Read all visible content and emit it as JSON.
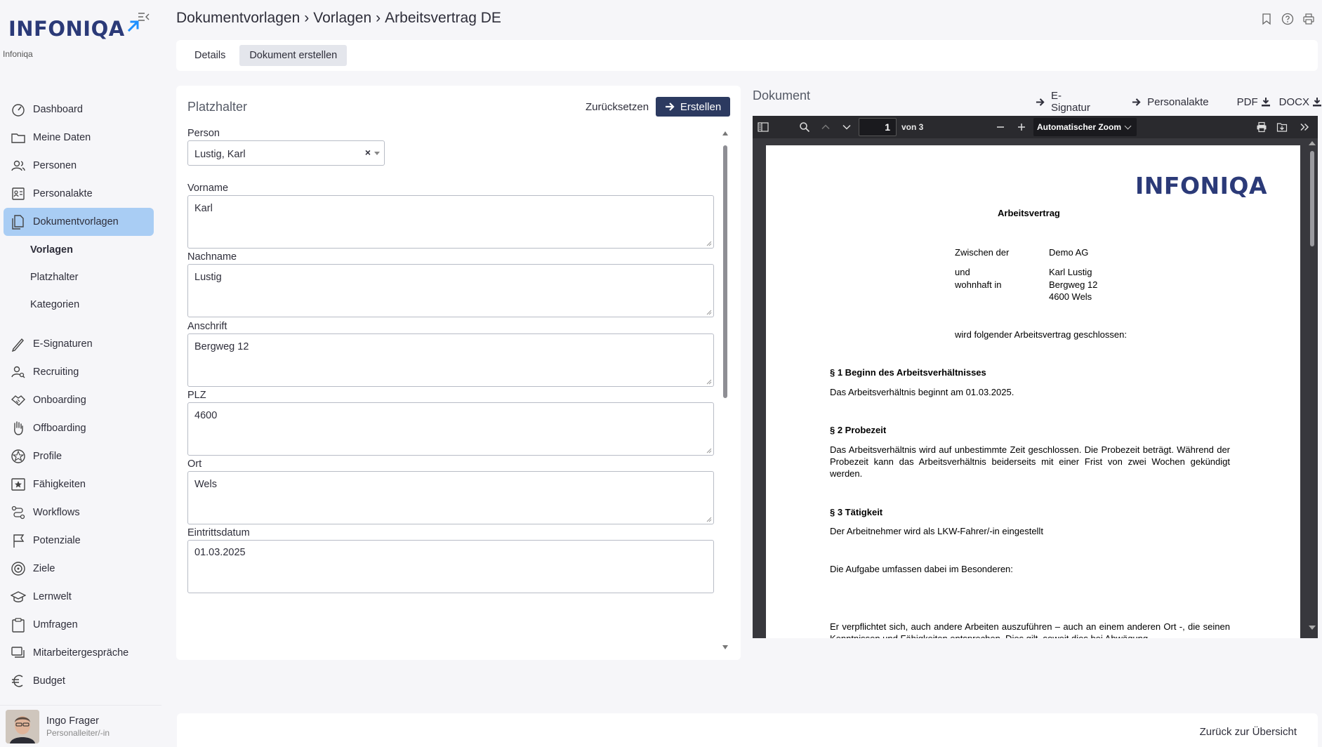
{
  "app": {
    "logo_text": "INFONIQA",
    "company": "Infoniqa",
    "brand_color": "#2b3a78",
    "accent_color": "#a9cdf4"
  },
  "breadcrumb": {
    "part1": "Dokumentvorlagen",
    "sep1": "›",
    "part2": "Vorlagen",
    "sep2": "›",
    "part3": "Arbeitsvertrag DE"
  },
  "header_icons": [
    "bookmark-icon",
    "help-icon",
    "print-icon"
  ],
  "sidebar": {
    "items": [
      {
        "label": "Dashboard",
        "icon": "dashboard-icon"
      },
      {
        "label": "Meine Daten",
        "icon": "folder-icon"
      },
      {
        "label": "Personen",
        "icon": "people-icon"
      },
      {
        "label": "Personalakte",
        "icon": "personnel-file-icon"
      },
      {
        "label": "Dokumentvorlagen",
        "icon": "documents-icon",
        "active": true
      },
      {
        "label": "E-Signaturen",
        "icon": "pen-icon"
      },
      {
        "label": "Recruiting",
        "icon": "recruiting-icon"
      },
      {
        "label": "Onboarding",
        "icon": "handshake-icon"
      },
      {
        "label": "Offboarding",
        "icon": "hand-icon"
      },
      {
        "label": "Profile",
        "icon": "profile-icon"
      },
      {
        "label": "Fähigkeiten",
        "icon": "star-icon"
      },
      {
        "label": "Workflows",
        "icon": "workflow-icon"
      },
      {
        "label": "Potenziale",
        "icon": "flag-icon"
      },
      {
        "label": "Ziele",
        "icon": "target-icon"
      },
      {
        "label": "Lernwelt",
        "icon": "graduation-icon"
      },
      {
        "label": "Umfragen",
        "icon": "clipboard-icon"
      },
      {
        "label": "Mitarbeitergespräche",
        "icon": "chat-icon"
      },
      {
        "label": "Budget",
        "icon": "euro-icon"
      }
    ],
    "sub_items": [
      {
        "label": "Vorlagen",
        "active": true
      },
      {
        "label": "Platzhalter"
      },
      {
        "label": "Kategorien"
      }
    ]
  },
  "user": {
    "name": "Ingo Frager",
    "role": "Personalleiter/-in"
  },
  "tabs": [
    {
      "label": "Details"
    },
    {
      "label": "Dokument erstellen",
      "active": true
    }
  ],
  "form": {
    "title": "Platzhalter",
    "reset_label": "Zurücksetzen",
    "create_label": "Erstellen",
    "person_label": "Person",
    "person_value": "Lustig, Karl",
    "clear_glyph": "×",
    "fields": [
      {
        "label": "Vorname",
        "value": "Karl"
      },
      {
        "label": "Nachname",
        "value": "Lustig"
      },
      {
        "label": "Anschrift",
        "value": "Bergweg 12"
      },
      {
        "label": "PLZ",
        "value": "4600"
      },
      {
        "label": "Ort",
        "value": "Wels"
      },
      {
        "label": "Eintrittsdatum",
        "value": "01.03.2025"
      }
    ]
  },
  "document": {
    "title": "Dokument",
    "actions": {
      "esign": "E-Signatur",
      "personnel_file": "Personalakte",
      "pdf": "PDF",
      "docx": "DOCX"
    },
    "viewer": {
      "page": "1",
      "page_of": "von 3",
      "zoom": "Automatischer Zoom"
    },
    "pdf": {
      "logo": "INFONIQA",
      "heading": "Arbeitsvertrag",
      "between_label": "Zwischen der",
      "between_value": "Demo AG",
      "and_label": "und",
      "residing_label": "wohnhaft in",
      "employee_name": "Karl Lustig",
      "employee_street": "Bergweg 12",
      "employee_city": "4600 Wels",
      "closing": "wird folgender Arbeitsvertrag geschlossen:",
      "s1_title": "§ 1 Beginn des Arbeitsverhältnisses",
      "s1_text": "Das Arbeitsverhältnis beginnt am 01.03.2025.",
      "s2_title": "§ 2 Probezeit",
      "s2_text": "Das Arbeitsverhältnis wird auf unbestimmte Zeit geschlossen. Die Probezeit beträgt. Während der Probezeit kann das Arbeitsverhältnis beiderseits mit einer Frist von zwei Wochen gekündigt werden.",
      "s3_title": "§ 3 Tätigkeit",
      "s3_text": "Der Arbeitnehmer wird als LKW-Fahrer/-in eingestellt",
      "tasks": "Die Aufgabe umfassen dabei im Besonderen:",
      "other_work": "Er verpflichtet sich, auch andere Arbeiten auszuführen – auch an einem anderen Ort -, die seinen Kenntnissen und Fähigkeiten entsprechen. Dies gilt, soweit dies bei Abwägung"
    }
  },
  "footer": {
    "back_label": "Zurück zur Übersicht"
  }
}
